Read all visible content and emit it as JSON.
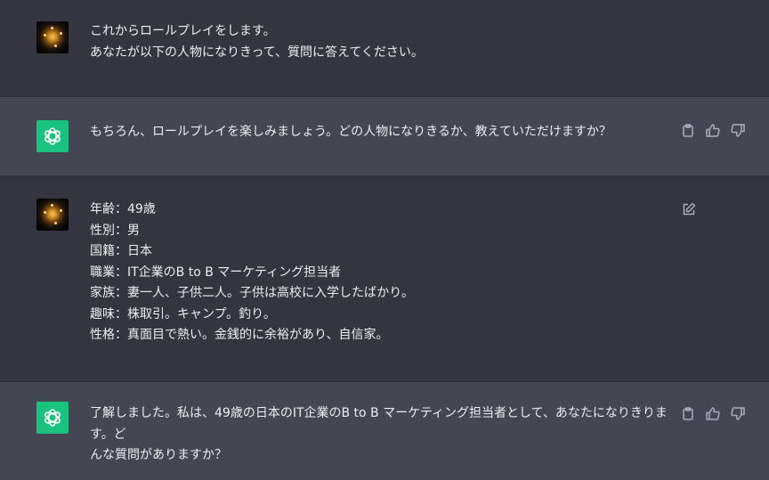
{
  "conversation": {
    "messages": [
      {
        "role": "user",
        "text": "これからロールプレイをします。\nあなたが以下の人物になりきって、質問に答えてください。"
      },
      {
        "role": "assistant",
        "text": "もちろん、ロールプレイを楽しみましょう。どの人物になりきるか、教えていただけますか？"
      },
      {
        "role": "user",
        "text": "年齢：49歳\n性別：男\n国籍：日本\n職業：IT企業のB to B マーケティング担当者\n家族：妻一人、子供二人。子供は高校に入学したばかり。\n趣味：株取引。キャンプ。釣り。\n性格：真面目で熱い。金銭的に余裕があり、自信家。"
      },
      {
        "role": "assistant",
        "text": "了解しました。私は、49歳の日本のIT企業のB to B マーケティング担当者として、あなたになりきります。ど\nんな質問がありますか？"
      }
    ]
  },
  "icons": {
    "user_avatar": "user-avatar-image",
    "assistant_avatar": "openai-logo-icon",
    "copy": "clipboard-icon",
    "like": "thumbs-up-icon",
    "dislike": "thumbs-down-icon",
    "edit": "edit-icon"
  },
  "colors": {
    "user_bg": "#343541",
    "assistant_bg": "#444654",
    "assistant_avatar_bg": "#19c37d",
    "text": "#ececf1",
    "icon": "#acacbe"
  }
}
